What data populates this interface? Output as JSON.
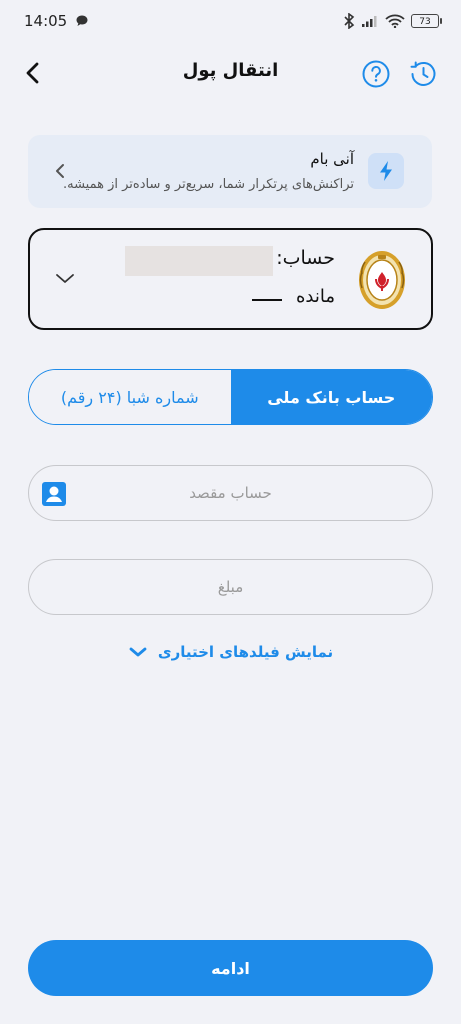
{
  "status_bar": {
    "time": "14:05",
    "battery": "73"
  },
  "header": {
    "title": "انتقال پول"
  },
  "promo": {
    "title": "آنی بام",
    "subtitle": "تراکنش‌های پرتکرار شما، سریع‌تر و ساده‌تر از همیشه."
  },
  "account": {
    "label": "حساب:",
    "balance_label": "مانده"
  },
  "tabs": {
    "bank_account": "حساب بانک ملی",
    "sheba": "شماره شبا (۲۴ رقم)"
  },
  "form": {
    "destination_placeholder": "حساب مقصد",
    "amount_placeholder": "مبلغ",
    "optional_fields_label": "نمایش فیلدهای اختیاری"
  },
  "continue_label": "ادامه",
  "colors": {
    "accent": "#1e8be9",
    "background": "#f1f2f7",
    "promo_bg": "#e6ecf6",
    "logo_gold": "#d6a02a"
  }
}
